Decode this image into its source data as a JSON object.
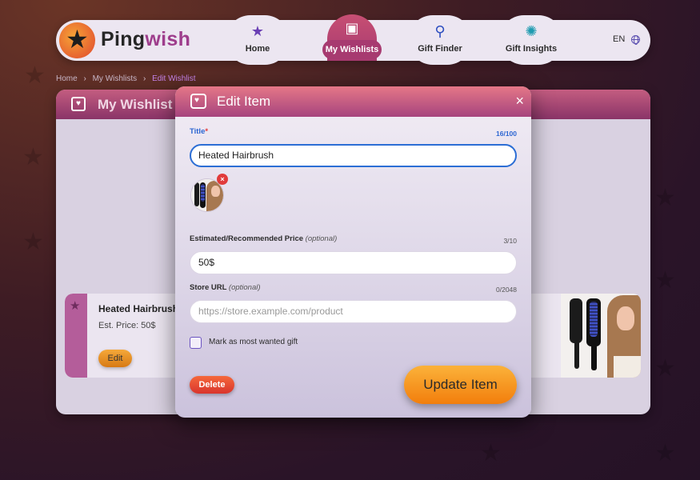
{
  "brand": {
    "name_part1": "Ping",
    "name_part2": "wish"
  },
  "nav": {
    "items": [
      {
        "label": "Home",
        "icon": "star-icon"
      },
      {
        "label": "My Wishlists",
        "icon": "gift-icon"
      },
      {
        "label": "Gift Finder",
        "icon": "search-icon"
      },
      {
        "label": "Gift Insights",
        "icon": "lightbulb-icon"
      }
    ],
    "active_index": 1,
    "language": "EN"
  },
  "breadcrumb": {
    "items": [
      "Home",
      "My Wishlists",
      "Edit Wishlist"
    ]
  },
  "panel": {
    "title": "My Wishlist"
  },
  "wish_card": {
    "name": "Heated Hairbrush",
    "price": "Est. Price: 50$",
    "edit_label": "Edit"
  },
  "modal": {
    "title": "Edit Item",
    "close_symbol": "×",
    "title_field": {
      "label": "Title",
      "required_mark": "*",
      "count": "16/100",
      "value": "Heated Hairbrush"
    },
    "image_remove_symbol": "×",
    "price_field": {
      "label": "Estimated/Recommended Price",
      "optional": "(optional)",
      "count": "3/10",
      "value": "50$"
    },
    "url_field": {
      "label": "Store URL",
      "optional": "(optional)",
      "count": "0/2048",
      "value": "",
      "placeholder": "https://store.example.com/product"
    },
    "most_wanted": {
      "label": "Mark as most wanted gift",
      "checked": false
    },
    "delete_label": "Delete",
    "update_label": "Update Item"
  },
  "colors": {
    "accent_pink": "#a6447e",
    "update_orange": "#f79a20",
    "delete_red": "#e2452f",
    "focus_blue": "#2c6ed5"
  }
}
